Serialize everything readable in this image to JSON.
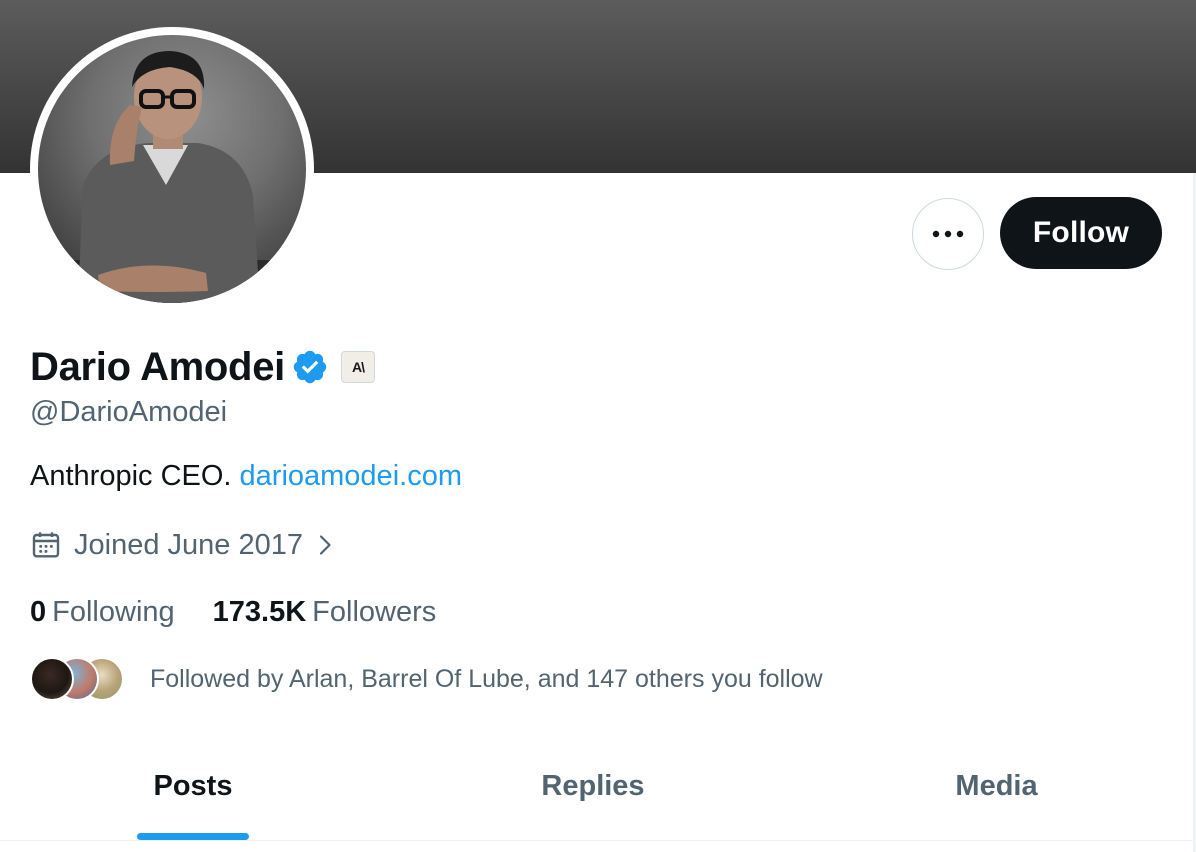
{
  "profile": {
    "display_name": "Dario Amodei",
    "handle": "@DarioAmodei",
    "affiliate_badge_text": "A\\",
    "bio_text": "Anthropic CEO. ",
    "bio_link": "darioamodei.com",
    "joined": "Joined June 2017",
    "following_count": "0",
    "following_label": "Following",
    "followers_count": "173.5K",
    "followers_label": "Followers",
    "followed_by": "Followed by Arlan, Barrel Of Lube, and 147 others you follow"
  },
  "actions": {
    "follow_label": "Follow",
    "more_icon": "ellipsis-icon"
  },
  "tabs": [
    {
      "label": "Posts",
      "active": true
    },
    {
      "label": "Replies",
      "active": false
    },
    {
      "label": "Media",
      "active": false
    }
  ],
  "colors": {
    "accent": "#1d9bf0",
    "text_primary": "#0f1419",
    "text_secondary": "#536471",
    "follow_button_bg": "#0f1419"
  }
}
